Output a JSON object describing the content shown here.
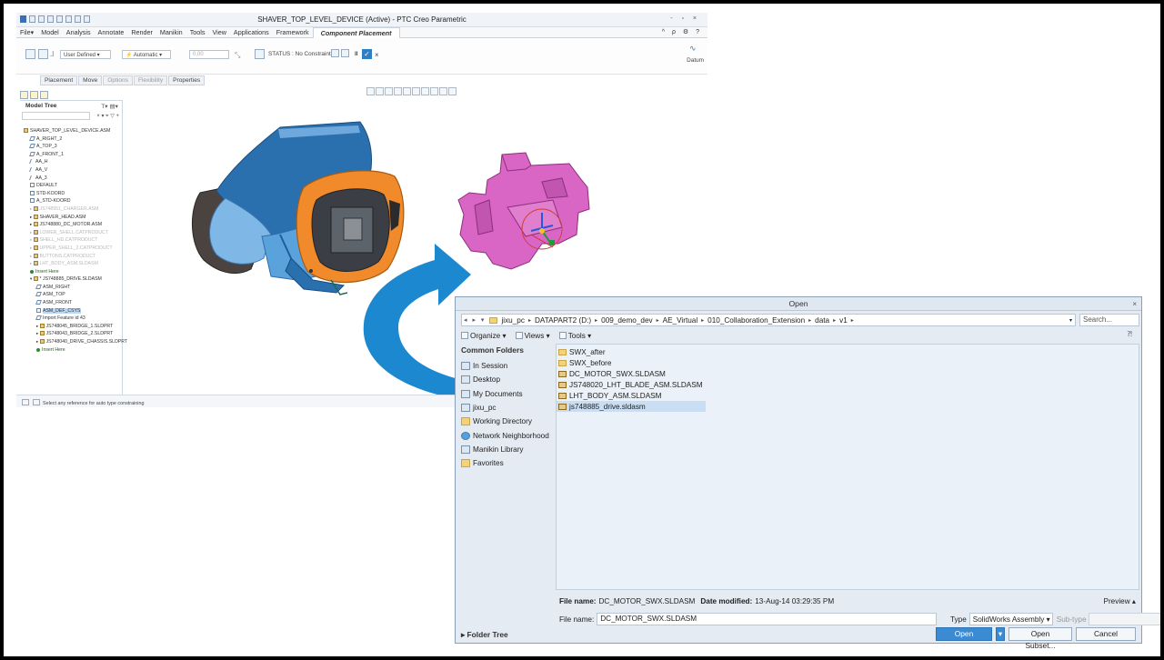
{
  "creo": {
    "title": "SHAVER_TOP_LEVEL_DEVICE (Active) - PTC Creo Parametric",
    "window_controls": "- ▫ ×",
    "menu": [
      "File▾",
      "Model",
      "Analysis",
      "Annotate",
      "Render",
      "Manikin",
      "Tools",
      "View",
      "Applications",
      "Framework"
    ],
    "active_tab": "Component Placement",
    "menu_right": "^ ρ ⚙ ?",
    "ribbon": {
      "constraint_type": "User Defined",
      "placement_mode": "Automatic",
      "offset_value": "0,00",
      "status": "STATUS : No Constraints",
      "pause": "II",
      "confirm": "✓",
      "cancel": "×",
      "datum_label": "Datum"
    },
    "subtabs": [
      "Placement",
      "Move",
      "Options",
      "Flexibility",
      "Properties"
    ],
    "model_tree": {
      "header": "Model Tree",
      "tools": "T▾ ▤▾",
      "search_tools": "× ▾ ⌖ ▽ +",
      "items": [
        {
          "label": "SHAVER_TOP_LEVEL_DEVICE.ASM",
          "icon": "asm",
          "indent": 0,
          "state": "normal"
        },
        {
          "label": "A_RIGHT_2",
          "icon": "pln",
          "indent": 1,
          "state": "normal"
        },
        {
          "label": "A_TOP_3",
          "icon": "pln",
          "indent": 1,
          "state": "normal"
        },
        {
          "label": "A_FRONT_1",
          "icon": "pln",
          "indent": 1,
          "state": "normal"
        },
        {
          "label": "AA_H",
          "icon": "axis",
          "indent": 1,
          "state": "normal"
        },
        {
          "label": "AA_V",
          "icon": "axis",
          "indent": 1,
          "state": "normal"
        },
        {
          "label": "AA_3",
          "icon": "axis",
          "indent": 1,
          "state": "normal"
        },
        {
          "label": "DEFAULT",
          "icon": "cs",
          "indent": 1,
          "state": "normal"
        },
        {
          "label": "STD-KOORD",
          "icon": "cs",
          "indent": 1,
          "state": "normal"
        },
        {
          "label": "A_STD-KOORD",
          "icon": "cs",
          "indent": 1,
          "state": "normal"
        },
        {
          "label": "JS748951_CHARGER.ASM",
          "icon": "asm",
          "indent": 1,
          "state": "dim"
        },
        {
          "label": "SHAVER_HEAD.ASM",
          "icon": "asm",
          "indent": 1,
          "state": "normal"
        },
        {
          "label": "JS748880_DC_MOTOR.ASM",
          "icon": "asm",
          "indent": 1,
          "state": "normal"
        },
        {
          "label": "LOWER_SHELL.CATPRODUCT",
          "icon": "asm",
          "indent": 1,
          "state": "dim"
        },
        {
          "label": "SHELL_HD.CATPRODUCT",
          "icon": "asm",
          "indent": 1,
          "state": "dim"
        },
        {
          "label": "UPPER_SHELL_2.CATPRODUCT",
          "icon": "asm",
          "indent": 1,
          "state": "dim"
        },
        {
          "label": "BUTTONS.CATPRODUCT",
          "icon": "asm",
          "indent": 1,
          "state": "dim"
        },
        {
          "label": "LHT_BODY_ASM.SLDASM",
          "icon": "asm",
          "indent": 1,
          "state": "dim"
        },
        {
          "label": "Insert Here",
          "icon": "ins",
          "indent": 1,
          "state": "insert"
        },
        {
          "label": "* JS748885_DRIVE.SLDASM",
          "icon": "asm",
          "indent": 1,
          "state": "normal"
        },
        {
          "label": "ASM_RIGHT",
          "icon": "pln",
          "indent": 2,
          "state": "normal"
        },
        {
          "label": "ASM_TOP",
          "icon": "pln",
          "indent": 2,
          "state": "normal"
        },
        {
          "label": "ASM_FRONT",
          "icon": "pln",
          "indent": 2,
          "state": "normal"
        },
        {
          "label": "ASM_DEF_CSYS",
          "icon": "cs",
          "indent": 2,
          "state": "selected"
        },
        {
          "label": "Import Feature id 43",
          "icon": "pln",
          "indent": 2,
          "state": "normal"
        },
        {
          "label": "JS748045_BRIDGE_1.SLDPRT",
          "icon": "asm",
          "indent": 2,
          "state": "normal"
        },
        {
          "label": "JS748043_BRIDGE_2.SLDPRT",
          "icon": "asm",
          "indent": 2,
          "state": "normal"
        },
        {
          "label": "JS748040_DRIVE_CHASSIS.SLDPRT",
          "icon": "asm",
          "indent": 2,
          "state": "normal"
        },
        {
          "label": "Insert Here",
          "icon": "ins",
          "indent": 2,
          "state": "insert"
        }
      ]
    },
    "status_text": "Select any reference for auto type constraining"
  },
  "dialog": {
    "title": "Open",
    "close": "×",
    "nav": "◂ ▸ ▾",
    "path": [
      "jixu_pc",
      "DATAPART2 (D:)",
      "009_demo_dev",
      "AE_Virtual",
      "010_Collaboration_Extension",
      "data",
      "v1"
    ],
    "search_placeholder": "Search...",
    "toolbar": {
      "organize": "Organize ▾",
      "views": "Views ▾",
      "tools": "Tools ▾"
    },
    "help_icon": "⁈",
    "common_folders_header": "Common Folders",
    "common_folders": [
      "In Session",
      "Desktop",
      "My Documents",
      "jixu_pc",
      "Working Directory",
      "Network Neighborhood",
      "Manikin Library",
      "Favorites"
    ],
    "files": [
      {
        "name": "SWX_after",
        "type": "folder"
      },
      {
        "name": "SWX_before",
        "type": "folder"
      },
      {
        "name": "DC_MOTOR_SWX.SLDASM",
        "type": "asm"
      },
      {
        "name": "JS748020_LHT_BLADE_ASM.SLDASM",
        "type": "asm"
      },
      {
        "name": "LHT_BODY_ASM.SLDASM",
        "type": "asm"
      },
      {
        "name": "js748885_drive.sldasm",
        "type": "asm",
        "selected": true
      }
    ],
    "info": {
      "file_name_label": "File name:",
      "file_name": "DC_MOTOR_SWX.SLDASM",
      "date_label": "Date modified:",
      "date": "13-Aug-14 03:29:35 PM",
      "preview": "Preview ▴"
    },
    "file_name_field_label": "File name:",
    "file_name_value": "DC_MOTOR_SWX.SLDASM",
    "type_label": "Type",
    "type_value": "SolidWorks Assembly",
    "subtype_label": "Sub-type",
    "folder_tree": "Folder Tree",
    "buttons": {
      "open": "Open",
      "open_subset": "Open Subset...",
      "cancel": "Cancel"
    }
  },
  "colors": {
    "accent": "#3b8bd4",
    "arrow": "#1b88d0",
    "pink_part": "#d966c4",
    "orange_part": "#f08a2a",
    "blue_part": "#2a6fae"
  }
}
